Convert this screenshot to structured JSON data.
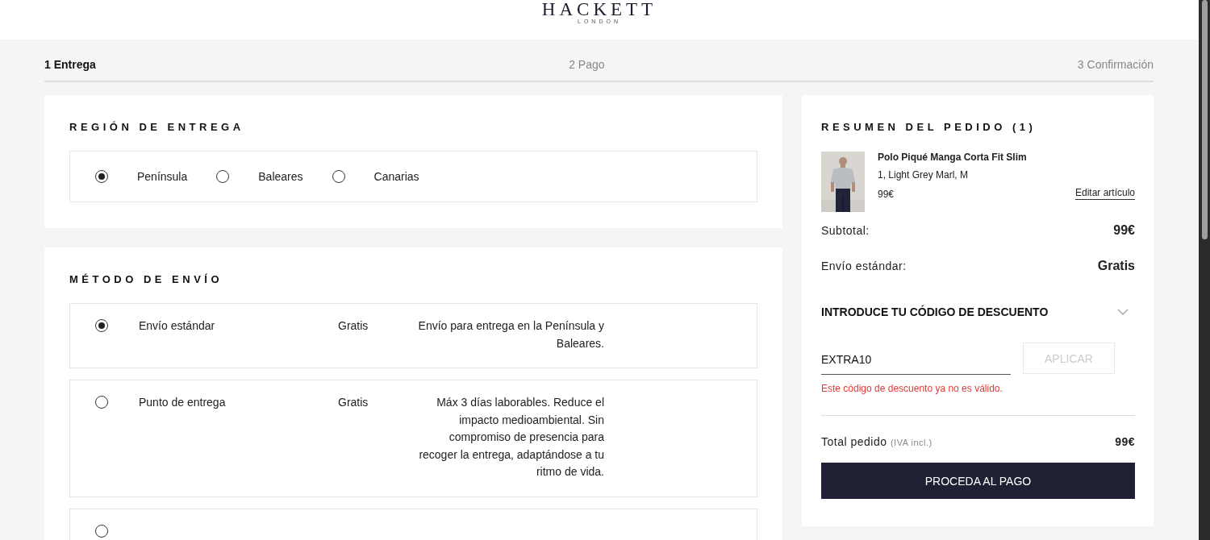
{
  "logo": {
    "name": "HACKETT",
    "sub": "LONDON"
  },
  "steps": [
    {
      "label": "1 Entrega",
      "selected": true
    },
    {
      "label": "2 Pago",
      "selected": false
    },
    {
      "label": "3 Confirmación",
      "selected": false
    }
  ],
  "region": {
    "title": "REGIÓN DE ENTREGA",
    "options": [
      {
        "label": "Península",
        "selected": true
      },
      {
        "label": "Baleares",
        "selected": false
      },
      {
        "label": "Canarias",
        "selected": false
      }
    ]
  },
  "shipping": {
    "title": "MÉTODO DE ENVÍO",
    "options": [
      {
        "name": "Envío estándar",
        "price": "Gratis",
        "description": "Envío para entrega en la Península y Baleares.",
        "selected": true
      },
      {
        "name": "Punto de entrega",
        "price": "Gratis",
        "description": "Máx 3 días laborables. Reduce el impacto medioambiental. Sin compromiso de presencia para recoger la entrega, adaptándose a tu ritmo de vida.",
        "selected": false
      },
      {
        "selected": false
      }
    ]
  },
  "summary": {
    "title": "RESUMEN DEL PEDIDO (1)",
    "item": {
      "kind": "picture",
      "name": "Polo Piqué Manga Corta Fit Slim",
      "variant": "1, Light Grey Marl, M",
      "price": "99€",
      "edit_link": "Editar artículo"
    },
    "rows": [
      {
        "label": "Subtotal:",
        "value": "99€"
      },
      {
        "label": "Envío estándar:",
        "value": "Gratis"
      }
    ],
    "discount": {
      "title": "INTRODUCE TU CÓDIGO DE DESCUENTO",
      "value": "EXTRA10",
      "button": "APLICAR",
      "error": "Este código de descuento ya no es válido."
    },
    "total": {
      "label": "Total pedido",
      "note": "(IVA incl.)",
      "value": "99€"
    },
    "checkout": "PROCEDA AL PAGO"
  }
}
